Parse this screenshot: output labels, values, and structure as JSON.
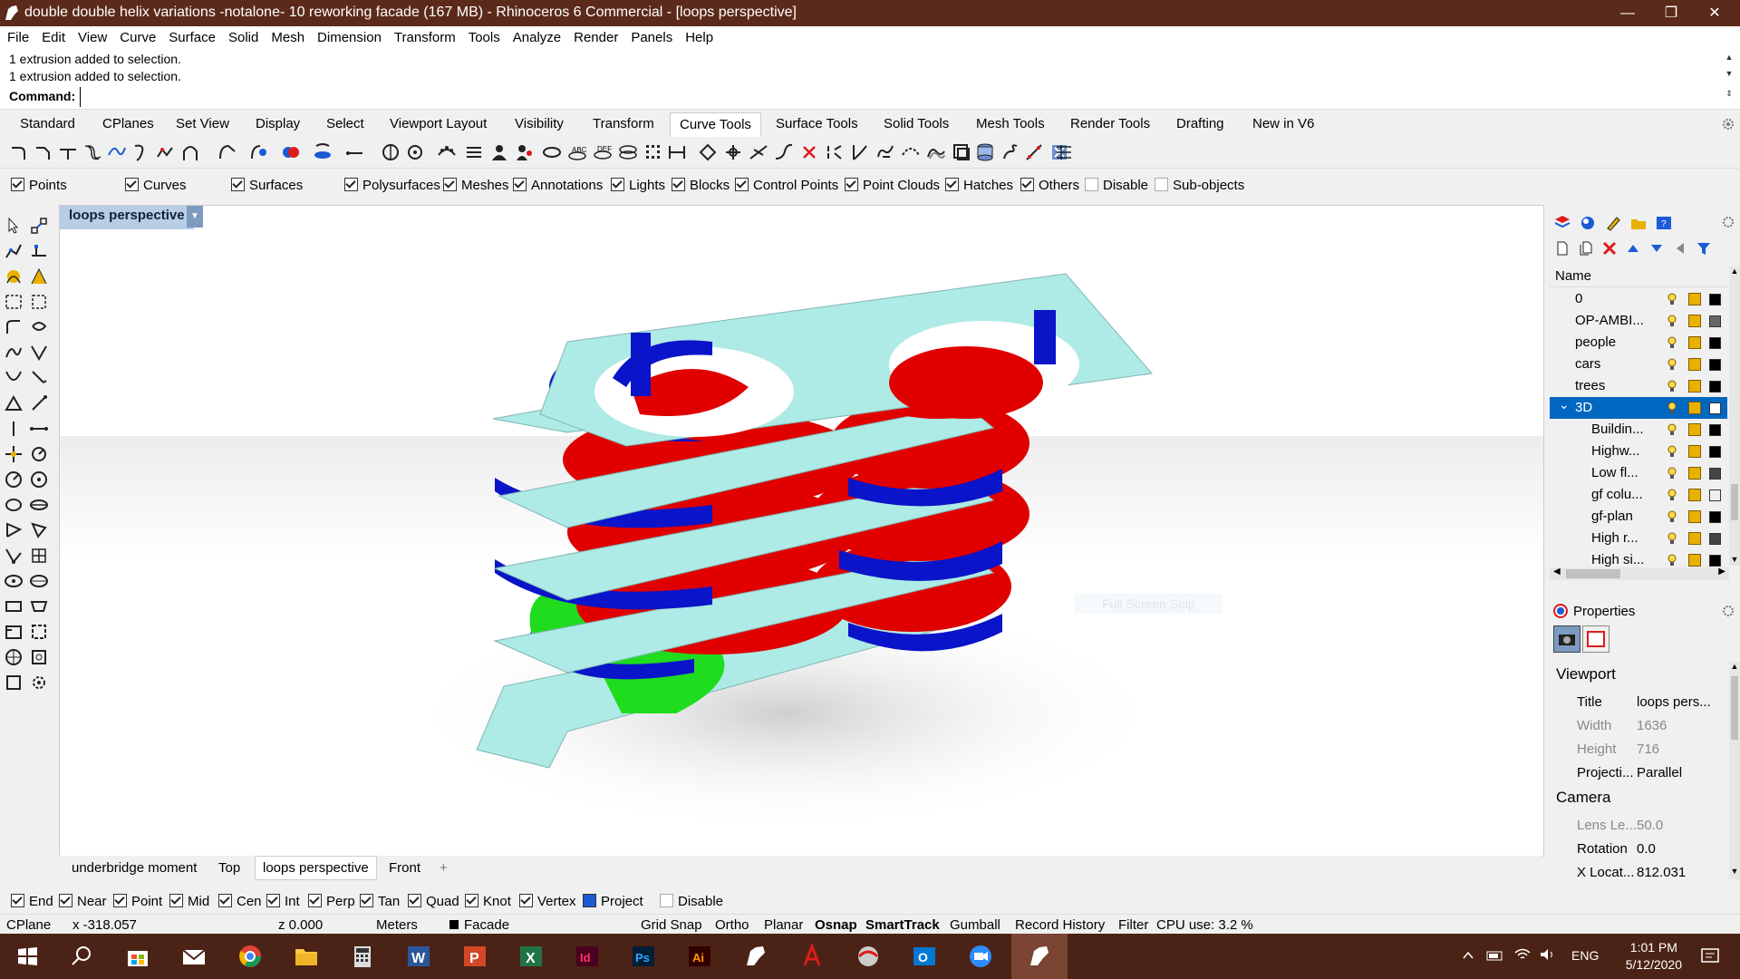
{
  "window": {
    "title": "double double helix variations -notalone- 10 reworking facade (167 MB) - Rhinoceros 6 Commercial - [loops perspective]",
    "controls": [
      "—",
      "❐",
      "✕"
    ]
  },
  "menu": [
    "File",
    "Edit",
    "View",
    "Curve",
    "Surface",
    "Solid",
    "Mesh",
    "Dimension",
    "Transform",
    "Tools",
    "Analyze",
    "Render",
    "Panels",
    "Help"
  ],
  "command": {
    "history": [
      "1 extrusion added to selection.",
      "1 extrusion added to selection."
    ],
    "label": "Command:",
    "value": ""
  },
  "toolbar_tabs": [
    "Standard",
    "CPlanes",
    "Set View",
    "Display",
    "Select",
    "Viewport Layout",
    "Visibility",
    "Transform",
    "Curve Tools",
    "Surface Tools",
    "Solid Tools",
    "Mesh Tools",
    "Render Tools",
    "Drafting",
    "New in V6"
  ],
  "active_toolbar_tab": "Curve Tools",
  "select_filter": [
    {
      "label": "Points",
      "checked": true
    },
    {
      "label": "Curves",
      "checked": true
    },
    {
      "label": "Surfaces",
      "checked": true
    },
    {
      "label": "Polysurfaces",
      "checked": true
    },
    {
      "label": "Meshes",
      "checked": true
    },
    {
      "label": "Annotations",
      "checked": true
    },
    {
      "label": "Lights",
      "checked": true
    },
    {
      "label": "Blocks",
      "checked": true
    },
    {
      "label": "Control Points",
      "checked": true
    },
    {
      "label": "Point Clouds",
      "checked": true
    },
    {
      "label": "Hatches",
      "checked": true
    },
    {
      "label": "Others",
      "checked": true
    },
    {
      "label": "Disable",
      "checked": false
    },
    {
      "label": "Sub-objects",
      "checked": false
    }
  ],
  "viewport": {
    "title": "loops perspective",
    "ghost_text": "Full Screen Snip"
  },
  "viewport_tabs": [
    "underbridge moment",
    "Top",
    "loops perspective",
    "Front",
    "+"
  ],
  "osnaps": [
    {
      "label": "End",
      "checked": true
    },
    {
      "label": "Near",
      "checked": true
    },
    {
      "label": "Point",
      "checked": true
    },
    {
      "label": "Mid",
      "checked": true
    },
    {
      "label": "Cen",
      "checked": true
    },
    {
      "label": "Int",
      "checked": true
    },
    {
      "label": "Perp",
      "checked": true
    },
    {
      "label": "Tan",
      "checked": true
    },
    {
      "label": "Quad",
      "checked": true
    },
    {
      "label": "Knot",
      "checked": true
    },
    {
      "label": "Vertex",
      "checked": true
    },
    {
      "label": "Project",
      "checked": false
    },
    {
      "label": "Disable",
      "checked": false
    }
  ],
  "status": {
    "cplane": "CPlane",
    "x": "x -318.057",
    "z": "z 0.000",
    "units": "Meters",
    "layer": "Facade",
    "toggles": [
      "Grid Snap",
      "Ortho",
      "Planar",
      "Osnap",
      "SmartTrack",
      "Gumball",
      "Record History",
      "Filter"
    ],
    "cpu": "CPU use: 3.2 %"
  },
  "layers": {
    "header": "Name",
    "rows": [
      {
        "name": "0",
        "indent": false,
        "selected": false,
        "color": "#000000"
      },
      {
        "name": "OP-AMBI...",
        "indent": false,
        "selected": false,
        "color": "#666666"
      },
      {
        "name": "people",
        "indent": false,
        "selected": false,
        "color": "#000000"
      },
      {
        "name": "cars",
        "indent": false,
        "selected": false,
        "color": "#000000"
      },
      {
        "name": "trees",
        "indent": false,
        "selected": false,
        "color": "#000000"
      },
      {
        "name": "3D",
        "indent": false,
        "selected": true,
        "color": "#ffffff"
      },
      {
        "name": "Buildin...",
        "indent": true,
        "selected": false,
        "color": "#000000"
      },
      {
        "name": "Highw...",
        "indent": true,
        "selected": false,
        "color": "#000000"
      },
      {
        "name": "Low fl...",
        "indent": true,
        "selected": false,
        "color": "#444444"
      },
      {
        "name": "gf colu...",
        "indent": true,
        "selected": false,
        "color": "#f0f0f0"
      },
      {
        "name": "gf-plan",
        "indent": true,
        "selected": false,
        "color": "#000000"
      },
      {
        "name": "High r...",
        "indent": true,
        "selected": false,
        "color": "#444444"
      },
      {
        "name": "High si...",
        "indent": true,
        "selected": false,
        "color": "#000000"
      }
    ]
  },
  "properties": {
    "header": "Properties",
    "viewport_section": "Viewport",
    "camera_section": "Camera",
    "viewport_rows": [
      {
        "label": "Title",
        "value": "loops pers...",
        "disabled": false
      },
      {
        "label": "Width",
        "value": "1636",
        "disabled": true
      },
      {
        "label": "Height",
        "value": "716",
        "disabled": true
      },
      {
        "label": "Projecti...",
        "value": "Parallel",
        "disabled": false
      }
    ],
    "camera_rows": [
      {
        "label": "Lens Le...",
        "value": "50.0",
        "disabled": true
      },
      {
        "label": "Rotation",
        "value": "0.0",
        "disabled": false
      },
      {
        "label": "X Locat...",
        "value": "812.031",
        "disabled": false
      }
    ]
  },
  "taskbar": {
    "lang": "ENG",
    "time": "1:01 PM",
    "date": "5/12/2020"
  },
  "colors": {
    "titlebar": "#5b2a1a",
    "taskbar": "#4b2316",
    "slab": "#aeeae6",
    "red": "#e00000",
    "blue": "#0a14c8",
    "green": "#1fdc1f"
  }
}
